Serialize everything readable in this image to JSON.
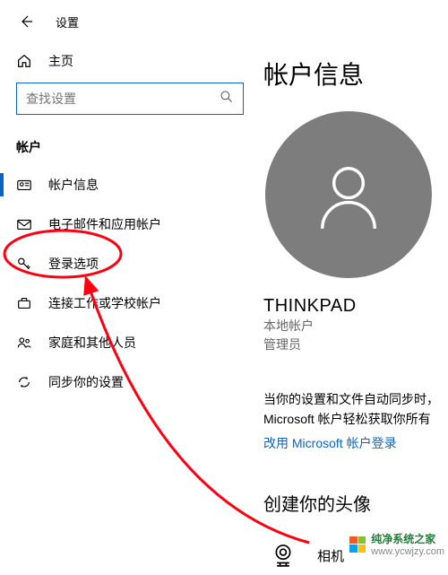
{
  "header": {
    "app_title": "设置"
  },
  "sidebar": {
    "home_label": "主页",
    "search_placeholder": "查找设置",
    "section_label": "帐户",
    "items": [
      {
        "label": "帐户信息"
      },
      {
        "label": "电子邮件和应用帐户"
      },
      {
        "label": "登录选项"
      },
      {
        "label": "连接工作或学校帐户"
      },
      {
        "label": "家庭和其他人员"
      },
      {
        "label": "同步你的设置"
      }
    ]
  },
  "main": {
    "page_title": "帐户信息",
    "user_name": "THINKPAD",
    "user_type": "本地帐户",
    "user_role": "管理员",
    "sync_text": "当你的设置和文件自动同步时，Microsoft 帐户轻松获取你所有",
    "link_text": "改用 Microsoft 帐户登录",
    "create_avatar_title": "创建你的头像",
    "camera_label": "相机"
  },
  "watermark": {
    "name": "纯净系统之家",
    "url": "www.ycwjzy.com"
  },
  "annotation": {
    "ellipse_label": "登录选项",
    "color": "#ff0013"
  }
}
